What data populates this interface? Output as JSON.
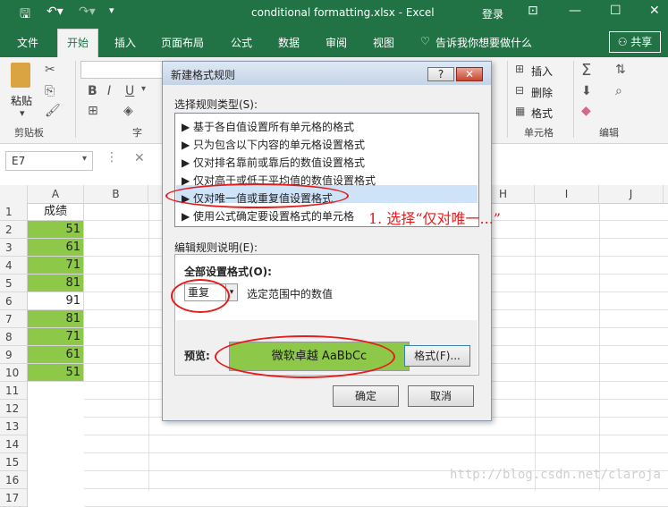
{
  "titlebar": {
    "title": "conditional formatting.xlsx - Excel",
    "login": "登录",
    "icons": [
      "save-icon",
      "undo-icon",
      "redo-icon",
      "customize-icon"
    ]
  },
  "tabs": {
    "file": "文件",
    "home": "开始",
    "insert": "插入",
    "page_layout": "页面布局",
    "formulas": "公式",
    "data": "数据",
    "review": "审阅",
    "view": "视图",
    "tell_me": "告诉我你想要做什么",
    "share": "共享"
  },
  "ribbon": {
    "paste": "粘贴",
    "clipboard": "剪贴板",
    "font": "字",
    "bold": "B",
    "italic": "I",
    "underline": "U",
    "insert": "插入",
    "delete": "删除",
    "format": "格式",
    "cells": "单元格",
    "editing": "编辑"
  },
  "formula_bar": {
    "name_box": "E7"
  },
  "sheet": {
    "columns": [
      "A",
      "B",
      "H",
      "I",
      "J"
    ],
    "rows": [
      "1",
      "2",
      "3",
      "4",
      "5",
      "6",
      "7",
      "8",
      "9",
      "10",
      "11",
      "12",
      "13",
      "14",
      "15",
      "16",
      "17"
    ],
    "header_cell": "成绩",
    "values": [
      "51",
      "61",
      "71",
      "81",
      "91",
      "81",
      "71",
      "61",
      "51"
    ],
    "highlight_color": "#8dc848"
  },
  "dialog": {
    "title": "新建格式规则",
    "help": "?",
    "close": "✕",
    "select_rule_type_label": "选择规则类型(S):",
    "rules": [
      "基于各自值设置所有单元格的格式",
      "只为包含以下内容的单元格设置格式",
      "仅对排名靠前或靠后的数值设置格式",
      "仅对高于或低于平均值的数值设置格式",
      "仅对唯一值或重复值设置格式",
      "使用公式确定要设置格式的单元格"
    ],
    "edit_rule_label": "编辑规则说明(E):",
    "format_all_label": "全部设置格式(O):",
    "dropdown_value": "重复",
    "dropdown_suffix": "选定范围中的数值",
    "preview_label": "预览:",
    "preview_text": "微软卓越  AaBbCc",
    "format_button": "格式(F)...",
    "ok_button": "确定",
    "cancel_button": "取消"
  },
  "annotation": "1. 选择“仅对唯一...”",
  "watermark": "http://blog.csdn.net/claroja",
  "colors": {
    "excel_green": "#217346",
    "annotation_red": "#e41c1c"
  }
}
